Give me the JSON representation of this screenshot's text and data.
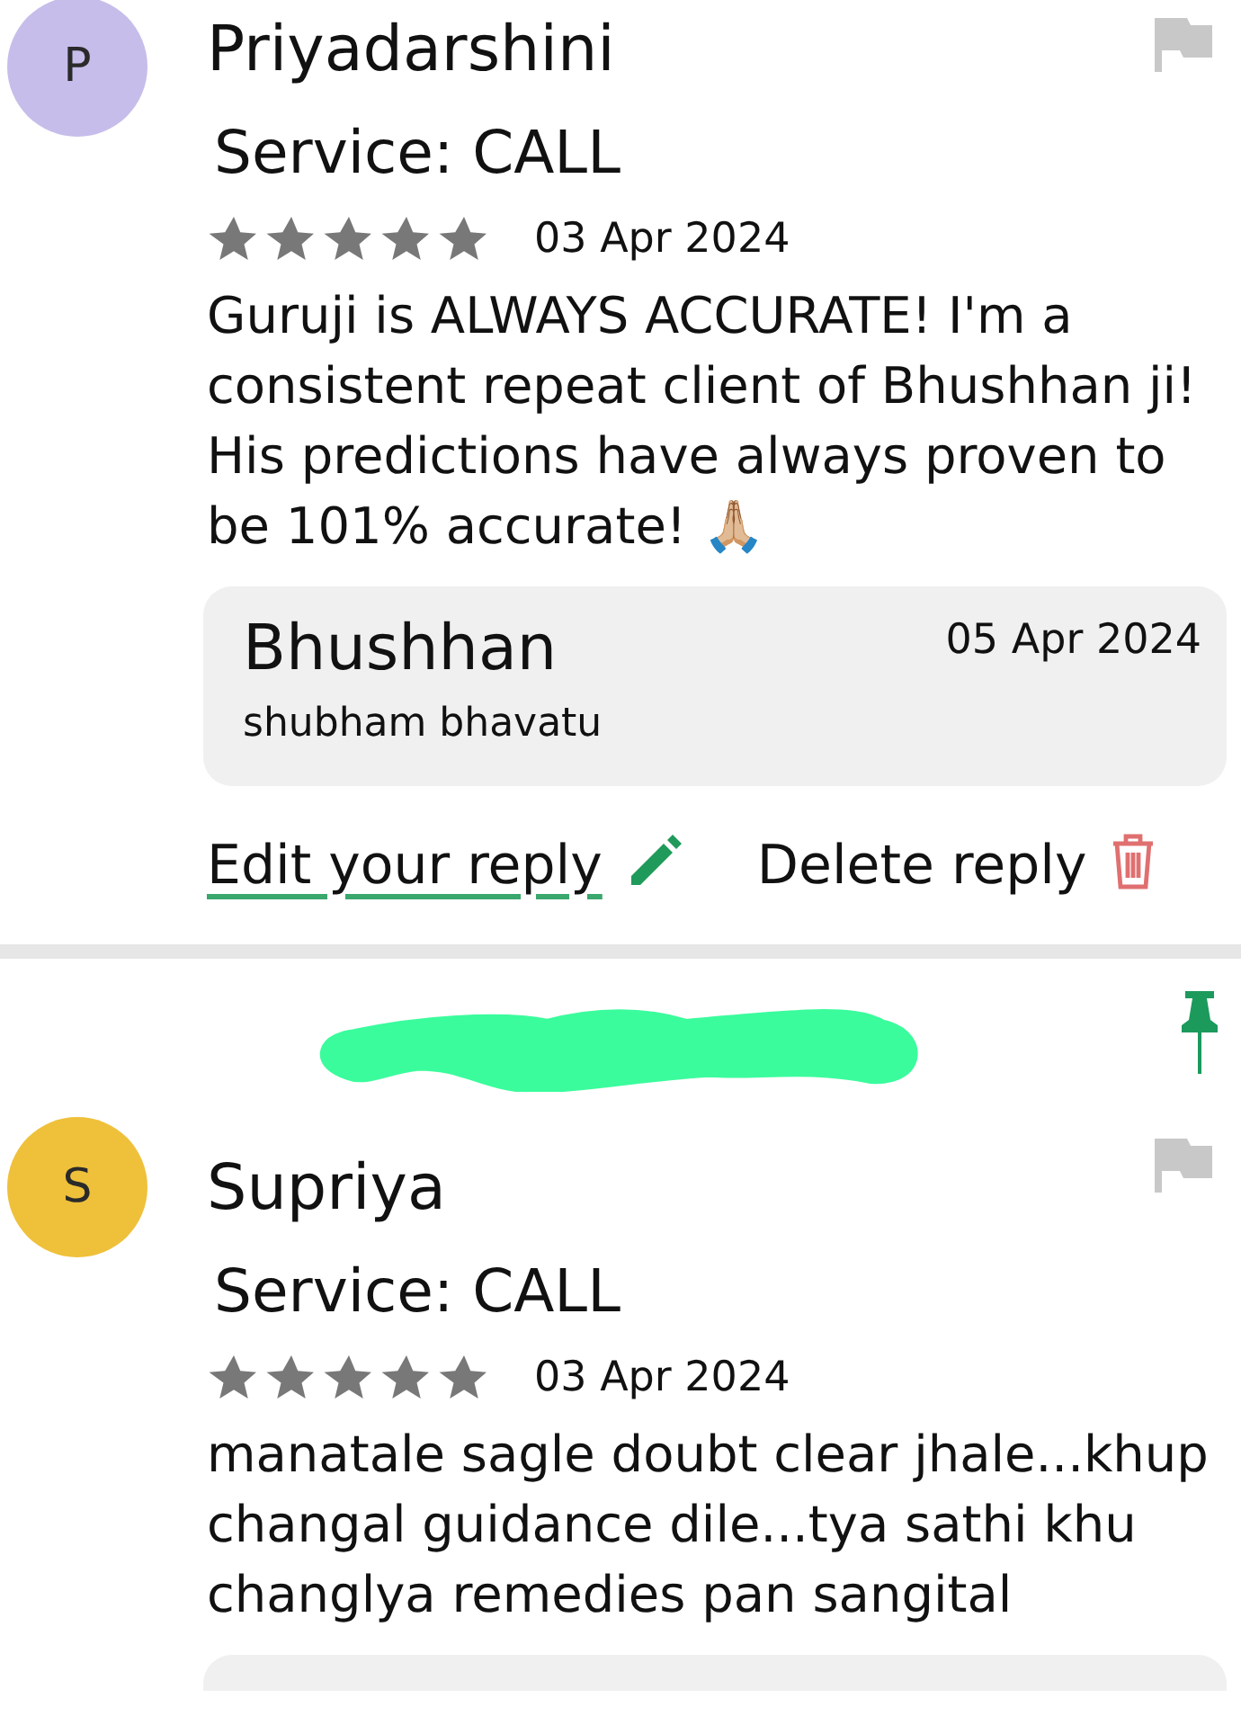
{
  "reviews": [
    {
      "avatar_letter": "P",
      "color": "#c7bdea",
      "name": "Priyadarshini",
      "service": "Service: CALL",
      "stars": 5,
      "date": "03 Apr 2024",
      "text": "Guruji is ALWAYS ACCURATE! I'm a consistent repeat client of Bhushhan ji! His predictions have always proven to be 101% accurate! 🙏🏼",
      "pinned": false,
      "redacted_header": false,
      "reply": {
        "author": "Bhushhan",
        "date": "05 Apr 2024",
        "text": "shubham bhavatu"
      },
      "actions": [
        {
          "kind": "edit",
          "label": "Edit your reply"
        },
        {
          "kind": "delete",
          "label": "Delete reply"
        }
      ]
    },
    {
      "avatar_letter": "S",
      "color": "#efc03a",
      "name": "Supriya",
      "service": "Service: CALL",
      "stars": 5,
      "date": "03 Apr 2024",
      "text": "manatale sagle doubt clear jhale...khup changal guidance dile...tya sathi khu changlya remedies pan sangital",
      "pinned": true,
      "redacted_header": true,
      "reply_box_partial": true
    }
  ]
}
